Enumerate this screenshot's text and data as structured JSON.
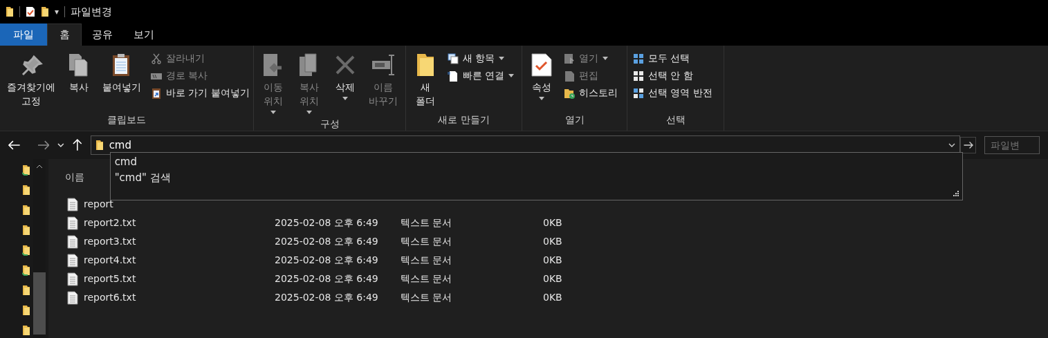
{
  "window": {
    "title": "파일변경"
  },
  "quick_access": {
    "dropdown": "▾"
  },
  "tabs": [
    {
      "label": "파일",
      "kind": "file",
      "selected": false
    },
    {
      "label": "홈",
      "kind": "tab",
      "selected": true
    },
    {
      "label": "공유",
      "kind": "tab",
      "selected": false
    },
    {
      "label": "보기",
      "kind": "tab",
      "selected": false
    }
  ],
  "ribbon": {
    "groups": [
      {
        "label": "클립보드",
        "kind": "clipboard",
        "large": [
          {
            "label": "즐겨찾기에\n고정",
            "disabled": false,
            "caret": false
          },
          {
            "label": "복사",
            "disabled": false,
            "caret": false
          },
          {
            "label": "붙여넣기",
            "disabled": false,
            "caret": false
          }
        ],
        "small": [
          {
            "label": "잘라내기",
            "disabled": true,
            "caret": false
          },
          {
            "label": "경로 복사",
            "disabled": true,
            "caret": false
          },
          {
            "label": "바로 가기 붙여넣기",
            "disabled": false,
            "caret": false
          }
        ]
      },
      {
        "label": "구성",
        "kind": "organize",
        "large": [
          {
            "label": "이동\n위치",
            "disabled": true,
            "caret": true
          },
          {
            "label": "복사\n위치",
            "disabled": true,
            "caret": true
          },
          {
            "label": "삭제",
            "disabled": false,
            "caret": true
          },
          {
            "label": "이름\n바꾸기",
            "disabled": true,
            "caret": false
          }
        ]
      },
      {
        "label": "새로 만들기",
        "kind": "new",
        "large": [
          {
            "label": "새\n폴더",
            "disabled": false,
            "caret": false
          }
        ],
        "small": [
          {
            "label": "새 항목",
            "disabled": false,
            "caret": true
          },
          {
            "label": "빠른 연결",
            "disabled": false,
            "caret": true
          }
        ]
      },
      {
        "label": "열기",
        "kind": "open",
        "large": [
          {
            "label": "속성",
            "disabled": false,
            "caret": true
          }
        ],
        "small": [
          {
            "label": "열기",
            "disabled": true,
            "caret": true
          },
          {
            "label": "편집",
            "disabled": true,
            "caret": false
          },
          {
            "label": "히스토리",
            "disabled": false,
            "caret": false
          }
        ]
      },
      {
        "label": "선택",
        "kind": "select",
        "small": [
          {
            "label": "모두 선택",
            "disabled": false,
            "caret": false
          },
          {
            "label": "선택 안 함",
            "disabled": false,
            "caret": false
          },
          {
            "label": "선택 영역 반전",
            "disabled": false,
            "caret": false
          }
        ]
      }
    ]
  },
  "address": {
    "value": "cmd",
    "suggestions": [
      "cmd",
      "\"cmd\" 검색"
    ]
  },
  "search": {
    "placeholder": "파일변"
  },
  "list": {
    "columns": [
      "이름"
    ],
    "rows": [
      {
        "name": "report"
      },
      {
        "name": "report2.txt",
        "date": "2025-02-08 오후 6:49",
        "type": "텍스트 문서",
        "size": "0KB"
      },
      {
        "name": "report3.txt",
        "date": "2025-02-08 오후 6:49",
        "type": "텍스트 문서",
        "size": "0KB"
      },
      {
        "name": "report4.txt",
        "date": "2025-02-08 오후 6:49",
        "type": "텍스트 문서",
        "size": "0KB"
      },
      {
        "name": "report5.txt",
        "date": "2025-02-08 오후 6:49",
        "type": "텍스트 문서",
        "size": "0KB"
      },
      {
        "name": "report6.txt",
        "date": "2025-02-08 오후 6:49",
        "type": "텍스트 문서",
        "size": "0KB"
      }
    ]
  }
}
